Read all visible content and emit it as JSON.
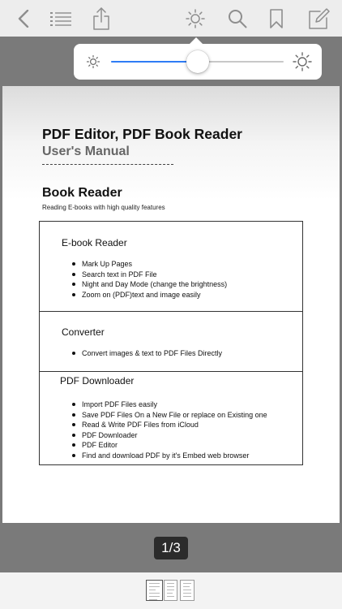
{
  "toolbar": {
    "icons": [
      "back-icon",
      "list-icon",
      "share-icon",
      "brightness-icon",
      "search-icon",
      "bookmark-icon",
      "edit-icon"
    ],
    "icon_color": "#8e8e8e"
  },
  "brightness": {
    "level": 0.5,
    "accent_color": "#2f7cf6"
  },
  "document": {
    "title": "PDF Editor, PDF Book Reader",
    "subtitle": "User's Manual",
    "section_heading": "Book Reader",
    "section_subheading": "Reading E-books with high quality features",
    "features": [
      {
        "title": "E-book Reader",
        "items": [
          "Mark Up Pages",
          "Search text in PDF File",
          "Night and Day Mode (change the brightness)",
          "Zoom on (PDF)text and image easily"
        ]
      },
      {
        "title": "Converter",
        "items": [
          "Convert images & text to PDF Files Directly"
        ]
      },
      {
        "title": "PDF Downloader",
        "items": [
          "Import PDF Files easily",
          "Save PDF Files On a New File or replace on Existing one",
          "Read & Write PDF Files from iCloud",
          "PDF Downloader",
          "PDF Editor",
          "Find and download PDF by it's Embed web browser"
        ]
      }
    ]
  },
  "pagination": {
    "indicator": "1/3",
    "current_page": 1,
    "total_pages": 3
  }
}
